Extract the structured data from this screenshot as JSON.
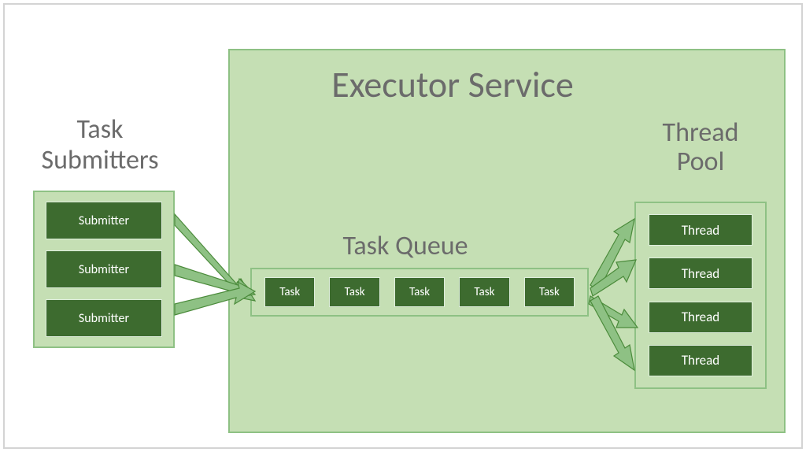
{
  "title": {
    "submitters_line1": "Task",
    "submitters_line2": "Submitters",
    "executor": "Executor Service",
    "queue": "Task Queue",
    "pool_line1": "Thread",
    "pool_line2": "Pool"
  },
  "submitters": [
    {
      "label": "Submitter"
    },
    {
      "label": "Submitter"
    },
    {
      "label": "Submitter"
    }
  ],
  "tasks": [
    {
      "label": "Task"
    },
    {
      "label": "Task"
    },
    {
      "label": "Task"
    },
    {
      "label": "Task"
    },
    {
      "label": "Task"
    }
  ],
  "threads": [
    {
      "label": "Thread"
    },
    {
      "label": "Thread"
    },
    {
      "label": "Thread"
    },
    {
      "label": "Thread"
    }
  ],
  "colors": {
    "light_green": "#c5dfb4",
    "border_green": "#8ec184",
    "dark_green": "#3d6b2f",
    "heading_gray": "#6b6b6b"
  }
}
